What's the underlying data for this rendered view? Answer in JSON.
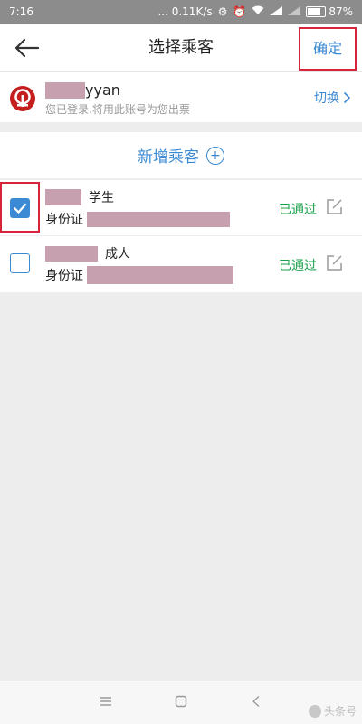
{
  "status_bar": {
    "time": "7:16",
    "speed": "... 0.11K/s",
    "battery": "87%",
    "battery_level": 0.87
  },
  "nav": {
    "title": "选择乘客",
    "confirm_label": "确定"
  },
  "account": {
    "name_suffix": "yyan",
    "hint": "您已登录,将用此账号为您出票",
    "switch_label": "切换"
  },
  "add_passenger": {
    "label": "新增乘客"
  },
  "passengers": [
    {
      "type": "学生",
      "id_label": "身份证",
      "status": "已通过",
      "checked": true
    },
    {
      "type": "成人",
      "id_label": "身份证",
      "status": "已通过",
      "checked": false
    }
  ],
  "watermark": "头条号",
  "colors": {
    "accent": "#3c8ad3",
    "highlight_border": "#d8243a",
    "status_green": "#18a24a",
    "mask": "#c6a0ae"
  }
}
